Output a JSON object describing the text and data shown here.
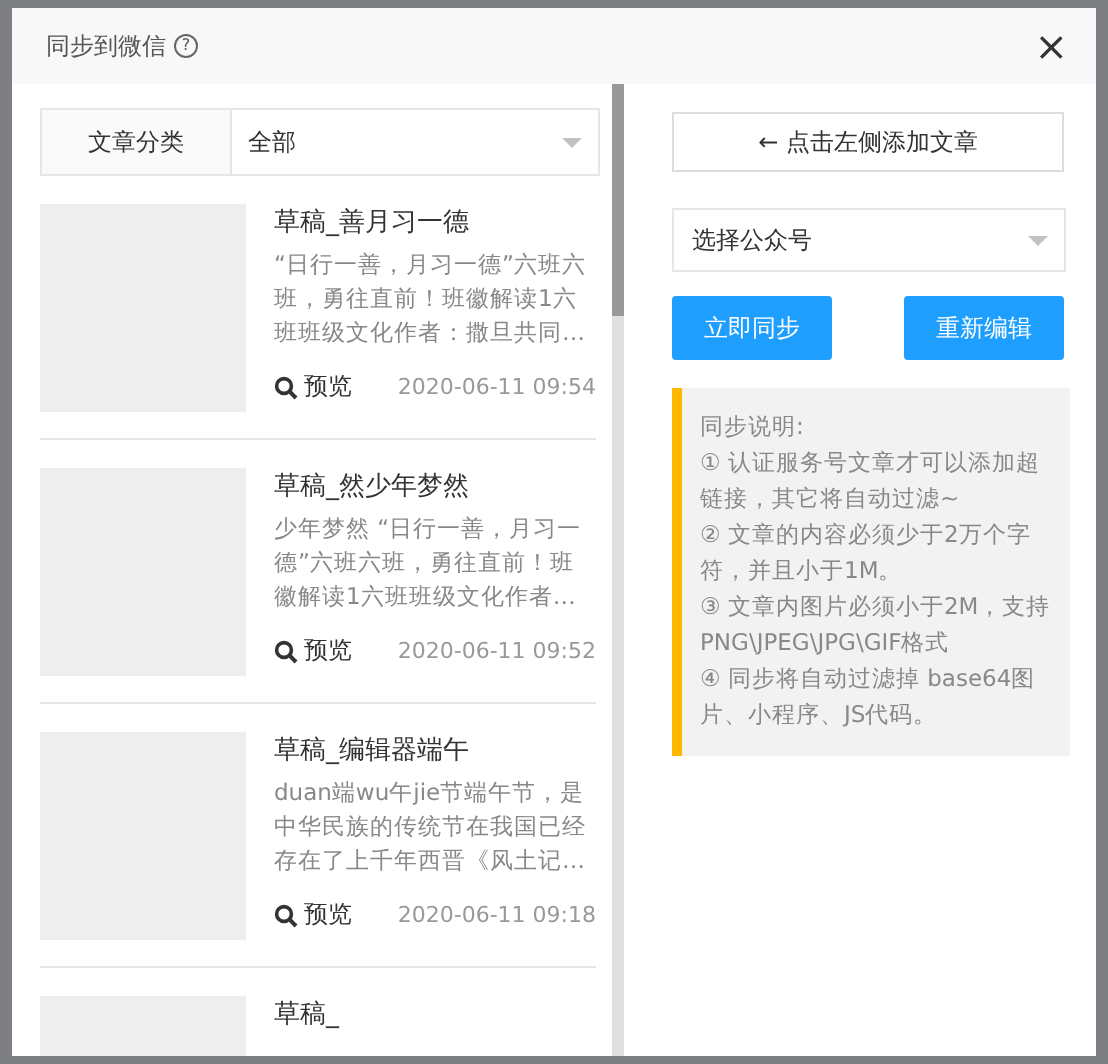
{
  "dialog": {
    "title": "同步到微信",
    "help_icon": "?",
    "close": "×"
  },
  "filter": {
    "label": "文章分类",
    "value": "全部"
  },
  "articles": [
    {
      "title": "草稿_善月习一德",
      "summary": "“日行一善，月习一德”六班六班，勇往直前！班徽解读1六班班级文化作者：撒旦共同…",
      "preview": "预览",
      "date": "2020-06-11 09:54"
    },
    {
      "title": "草稿_然少年梦然",
      "summary": "少年梦然 “日行一善，月习一德”六班六班，勇往直前！班徽解读1六班班级文化作者…",
      "preview": "预览",
      "date": "2020-06-11 09:52"
    },
    {
      "title": "草稿_编辑器端午",
      "summary": "duan端wu午jie节端午节，是中华民族的传统节在我国已经存在了上千年西晋《风土记…",
      "preview": "预览",
      "date": "2020-06-11 09:18"
    },
    {
      "title": "草稿_"
    }
  ],
  "add_button": "← 点击左侧添加文章",
  "account_select": {
    "placeholder": "选择公众号"
  },
  "buttons": [
    "立即同步",
    "重新编辑"
  ],
  "notes": {
    "heading": "同步说明:",
    "items": [
      "① 认证服务号文章才可以添加超链接，其它将自动过滤~",
      "② 文章的内容必须少于2万个字符，并且小于1M。",
      "③ 文章内图片必须小于2M，支持PNG\\JPEG\\JPG\\GIF格式",
      "④ 同步将自动过滤掉 base64图片、小程序、JS代码。"
    ]
  }
}
